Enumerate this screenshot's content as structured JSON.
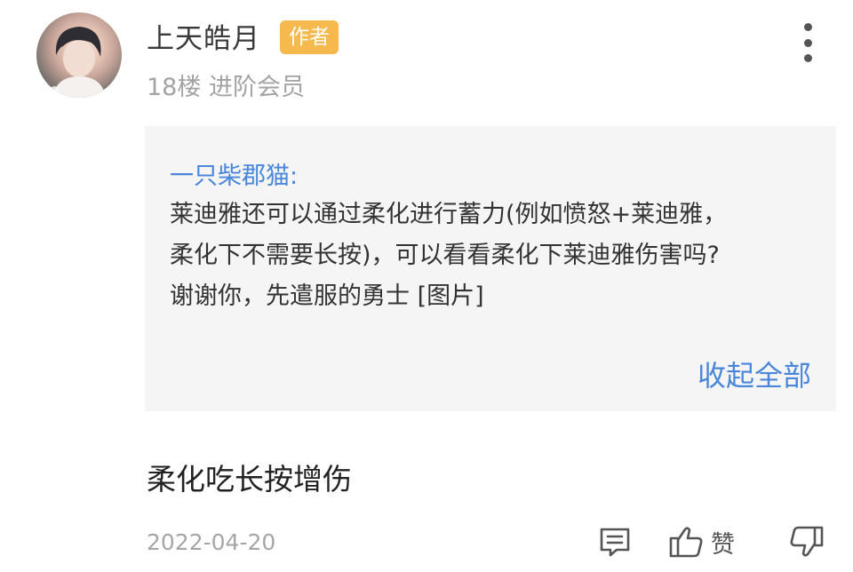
{
  "post": {
    "username": "上天皓月",
    "badge": "作者",
    "meta": "18楼 进阶会员"
  },
  "quote": {
    "author": "一只柴郡猫:",
    "lines": [
      "莱迪雅还可以通过柔化进行蓄力(例如愤怒+莱迪雅，",
      "柔化下不需要长按)，可以看看柔化下莱迪雅伤害吗?",
      "谢谢你，先遣服的勇士 [图片]"
    ],
    "collapse_label": "收起全部"
  },
  "reply": {
    "text": "柔化吃长按增伤"
  },
  "footer": {
    "date": "2022-04-20",
    "like_label": "赞"
  },
  "icons": {
    "more": "more-vertical-icon",
    "comment": "comment-icon",
    "like": "thumbs-up-icon",
    "dislike": "thumbs-down-icon"
  },
  "colors": {
    "badge": "#f5b94e",
    "link": "#4a86d9",
    "quote_bg": "#f5f5f5",
    "muted": "#a3a3a3"
  }
}
